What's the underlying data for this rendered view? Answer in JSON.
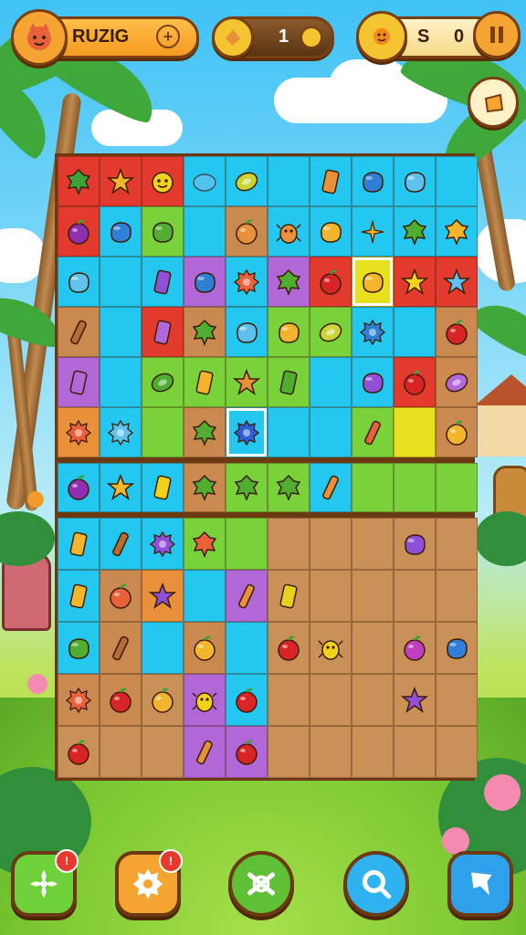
{
  "topbar": {
    "title": "RUZIG",
    "coins_value": "1",
    "score_value": "S",
    "score_number": "0"
  },
  "colors": {
    "cyan": "#23c7ef",
    "red": "#e23a2c",
    "green": "#79d23a",
    "brown": "#c9894f",
    "purple": "#b267d6",
    "orange": "#e8913a",
    "yellow": "#e6e01e",
    "dirt": "#c99057",
    "white_border": "#ffffff"
  },
  "board": {
    "rows": [
      [
        {
          "bg": "red",
          "icon": "leaf",
          "c": "#3aa335"
        },
        {
          "bg": "red",
          "icon": "star",
          "c": "#f2b52b"
        },
        {
          "bg": "red",
          "icon": "face",
          "c": "#f2d21b"
        },
        {
          "bg": "cyan",
          "icon": "drop",
          "c": "#5fc2ee"
        },
        {
          "bg": "cyan",
          "icon": "bean",
          "c": "#cbd636"
        },
        {
          "bg": "cyan",
          "icon": "none",
          "c": ""
        },
        {
          "bg": "cyan",
          "icon": "block",
          "c": "#e8913a"
        },
        {
          "bg": "cyan",
          "icon": "blob",
          "c": "#2f7fd6"
        },
        {
          "bg": "cyan",
          "icon": "blob",
          "c": "#5fc2ee"
        },
        {
          "bg": "cyan",
          "icon": "none",
          "c": ""
        }
      ],
      [
        {
          "bg": "red",
          "icon": "fruit",
          "c": "#8f2fb0"
        },
        {
          "bg": "cyan",
          "icon": "blob",
          "c": "#2f7fd6"
        },
        {
          "bg": "green",
          "icon": "blob",
          "c": "#4fae2f"
        },
        {
          "bg": "cyan",
          "icon": "none",
          "c": ""
        },
        {
          "bg": "brown",
          "icon": "fruit",
          "c": "#e8913a"
        },
        {
          "bg": "cyan",
          "icon": "bug",
          "c": "#e8913a"
        },
        {
          "bg": "cyan",
          "icon": "blob",
          "c": "#f2b52b"
        },
        {
          "bg": "cyan",
          "icon": "spark",
          "c": "#f2b52b"
        },
        {
          "bg": "cyan",
          "icon": "leaf",
          "c": "#4fae2f"
        },
        {
          "bg": "cyan",
          "icon": "leaf",
          "c": "#f2b52b"
        }
      ],
      [
        {
          "bg": "cyan",
          "icon": "blob",
          "c": "#5fc2ee"
        },
        {
          "bg": "cyan",
          "icon": "none",
          "c": ""
        },
        {
          "bg": "cyan",
          "icon": "block",
          "c": "#8f4fd6"
        },
        {
          "bg": "purple",
          "icon": "blob",
          "c": "#2f7fd6"
        },
        {
          "bg": "cyan",
          "icon": "gear",
          "c": "#e8613a"
        },
        {
          "bg": "purple",
          "icon": "leaf",
          "c": "#4fae2f"
        },
        {
          "bg": "red",
          "icon": "fruit",
          "c": "#d82424"
        },
        {
          "bg": "yellow",
          "icon": "blob",
          "c": "#f2b52b",
          "sel": true
        },
        {
          "bg": "red",
          "icon": "star",
          "c": "#f2d21b"
        },
        {
          "bg": "red",
          "icon": "star",
          "c": "#5fc2ee"
        }
      ],
      [
        {
          "bg": "brown",
          "icon": "stick",
          "c": "#b86b33"
        },
        {
          "bg": "cyan",
          "icon": "none",
          "c": ""
        },
        {
          "bg": "red",
          "icon": "block",
          "c": "#b267d6"
        },
        {
          "bg": "brown",
          "icon": "leaf",
          "c": "#4fae2f"
        },
        {
          "bg": "cyan",
          "icon": "blob",
          "c": "#5fc2ee"
        },
        {
          "bg": "green",
          "icon": "blob",
          "c": "#f2b52b"
        },
        {
          "bg": "green",
          "icon": "bean",
          "c": "#cbd636"
        },
        {
          "bg": "cyan",
          "icon": "gear",
          "c": "#2f7fd6"
        },
        {
          "bg": "cyan",
          "icon": "none",
          "c": ""
        },
        {
          "bg": "brown",
          "icon": "fruit",
          "c": "#d82424"
        }
      ],
      [
        {
          "bg": "purple",
          "icon": "block",
          "c": "#b267d6"
        },
        {
          "bg": "cyan",
          "icon": "none",
          "c": ""
        },
        {
          "bg": "green",
          "icon": "bean",
          "c": "#4fae2f"
        },
        {
          "bg": "green",
          "icon": "block",
          "c": "#f2b52b"
        },
        {
          "bg": "green",
          "icon": "star",
          "c": "#e8913a"
        },
        {
          "bg": "green",
          "icon": "block",
          "c": "#4fae2f"
        },
        {
          "bg": "cyan",
          "icon": "none",
          "c": ""
        },
        {
          "bg": "cyan",
          "icon": "blob",
          "c": "#8f4fd6"
        },
        {
          "bg": "red",
          "icon": "fruit",
          "c": "#d82424"
        },
        {
          "bg": "brown",
          "icon": "bean",
          "c": "#b267d6"
        }
      ],
      [
        {
          "bg": "orange",
          "icon": "gear",
          "c": "#e8613a"
        },
        {
          "bg": "cyan",
          "icon": "gear",
          "c": "#5fc2ee"
        },
        {
          "bg": "green",
          "icon": "none",
          "c": ""
        },
        {
          "bg": "brown",
          "icon": "leaf",
          "c": "#4fae2f"
        },
        {
          "bg": "cyan",
          "icon": "gear",
          "c": "#2f5fd6",
          "sel": true
        },
        {
          "bg": "cyan",
          "icon": "none",
          "c": ""
        },
        {
          "bg": "cyan",
          "icon": "none",
          "c": ""
        },
        {
          "bg": "green",
          "icon": "stick",
          "c": "#e8613a"
        },
        {
          "bg": "yellow",
          "icon": "none",
          "c": ""
        },
        {
          "bg": "brown",
          "icon": "fruit",
          "c": "#f2b52b"
        }
      ]
    ],
    "middle_row": [
      {
        "bg": "cyan",
        "icon": "fruit",
        "c": "#8f2fb0"
      },
      {
        "bg": "cyan",
        "icon": "star",
        "c": "#f2b52b"
      },
      {
        "bg": "cyan",
        "icon": "block",
        "c": "#f2d21b"
      },
      {
        "bg": "brown",
        "icon": "leaf",
        "c": "#4fae2f"
      },
      {
        "bg": "green",
        "icon": "leaf",
        "c": "#4fae2f"
      },
      {
        "bg": "green",
        "icon": "leaf",
        "c": "#4fae2f"
      },
      {
        "bg": "cyan",
        "icon": "stick",
        "c": "#e8913a"
      },
      {
        "bg": "green",
        "icon": "none",
        "c": ""
      },
      {
        "bg": "green",
        "icon": "none",
        "c": ""
      },
      {
        "bg": "green",
        "icon": "none",
        "c": ""
      }
    ],
    "lower_rows": [
      [
        {
          "bg": "cyan",
          "icon": "block",
          "c": "#f2b52b"
        },
        {
          "bg": "cyan",
          "icon": "stick",
          "c": "#b86b33"
        },
        {
          "bg": "cyan",
          "icon": "gear",
          "c": "#8f4fd6"
        },
        {
          "bg": "green",
          "icon": "leaf",
          "c": "#e8613a"
        },
        {
          "bg": "green",
          "icon": "none",
          "c": ""
        },
        {
          "bg": "dirt",
          "icon": "none",
          "c": ""
        },
        {
          "bg": "dirt",
          "icon": "none",
          "c": ""
        },
        {
          "bg": "dirt",
          "icon": "none",
          "c": ""
        },
        {
          "bg": "dirt",
          "icon": "blob",
          "c": "#8f4fd6"
        },
        {
          "bg": "dirt",
          "icon": "none",
          "c": ""
        }
      ],
      [
        {
          "bg": "cyan",
          "icon": "block",
          "c": "#f2b52b"
        },
        {
          "bg": "brown",
          "icon": "fruit",
          "c": "#e8613a"
        },
        {
          "bg": "orange",
          "icon": "star",
          "c": "#8f4fd6"
        },
        {
          "bg": "cyan",
          "icon": "none",
          "c": ""
        },
        {
          "bg": "purple",
          "icon": "stick",
          "c": "#e8913a"
        },
        {
          "bg": "dirt",
          "icon": "block",
          "c": "#e6d21e"
        },
        {
          "bg": "dirt",
          "icon": "none",
          "c": ""
        },
        {
          "bg": "dirt",
          "icon": "none",
          "c": ""
        },
        {
          "bg": "dirt",
          "icon": "none",
          "c": ""
        },
        {
          "bg": "dirt",
          "icon": "none",
          "c": ""
        }
      ],
      [
        {
          "bg": "cyan",
          "icon": "blob",
          "c": "#4fae2f"
        },
        {
          "bg": "brown",
          "icon": "stick",
          "c": "#b86b33"
        },
        {
          "bg": "cyan",
          "icon": "none",
          "c": ""
        },
        {
          "bg": "brown",
          "icon": "fruit",
          "c": "#f2b52b"
        },
        {
          "bg": "cyan",
          "icon": "none",
          "c": ""
        },
        {
          "bg": "dirt",
          "icon": "fruit",
          "c": "#d82424"
        },
        {
          "bg": "dirt",
          "icon": "bug",
          "c": "#f2d21b"
        },
        {
          "bg": "dirt",
          "icon": "none",
          "c": ""
        },
        {
          "bg": "dirt",
          "icon": "fruit",
          "c": "#c03fc0"
        },
        {
          "bg": "dirt",
          "icon": "blob",
          "c": "#2f7fd6"
        }
      ],
      [
        {
          "bg": "brown",
          "icon": "gear",
          "c": "#e8613a"
        },
        {
          "bg": "brown",
          "icon": "fruit",
          "c": "#d82424"
        },
        {
          "bg": "dirt",
          "icon": "fruit",
          "c": "#f2b52b"
        },
        {
          "bg": "purple",
          "icon": "bug",
          "c": "#f2d21b"
        },
        {
          "bg": "cyan",
          "icon": "fruit",
          "c": "#d82424"
        },
        {
          "bg": "dirt",
          "icon": "none",
          "c": ""
        },
        {
          "bg": "dirt",
          "icon": "none",
          "c": ""
        },
        {
          "bg": "dirt",
          "icon": "none",
          "c": ""
        },
        {
          "bg": "dirt",
          "icon": "star",
          "c": "#8f4fd6"
        },
        {
          "bg": "dirt",
          "icon": "none",
          "c": ""
        }
      ],
      [
        {
          "bg": "dirt",
          "icon": "fruit",
          "c": "#d82424"
        },
        {
          "bg": "dirt",
          "icon": "none",
          "c": ""
        },
        {
          "bg": "dirt",
          "icon": "none",
          "c": ""
        },
        {
          "bg": "purple",
          "icon": "stick",
          "c": "#e8913a"
        },
        {
          "bg": "purple",
          "icon": "fruit",
          "c": "#d82424"
        },
        {
          "bg": "dirt",
          "icon": "none",
          "c": ""
        },
        {
          "bg": "dirt",
          "icon": "none",
          "c": ""
        },
        {
          "bg": "dirt",
          "icon": "none",
          "c": ""
        },
        {
          "bg": "dirt",
          "icon": "none",
          "c": ""
        },
        {
          "bg": "dirt",
          "icon": "none",
          "c": ""
        }
      ]
    ]
  },
  "bottom_bar": {
    "buttons": [
      {
        "name": "flower-button",
        "icon": "flower-icon",
        "color": "#6fd23a",
        "notif": true
      },
      {
        "name": "settings-button",
        "icon": "gear-icon",
        "color": "#f5a431",
        "notif": true
      },
      {
        "name": "shuffle-button",
        "icon": "shuffle-icon",
        "color": "#5fbf35",
        "notif": false
      },
      {
        "name": "search-button",
        "icon": "search-icon",
        "color": "#2fb2f0",
        "notif": false
      },
      {
        "name": "hint-button",
        "icon": "hint-icon",
        "color": "#2fa0ec",
        "notif": false
      }
    ]
  }
}
